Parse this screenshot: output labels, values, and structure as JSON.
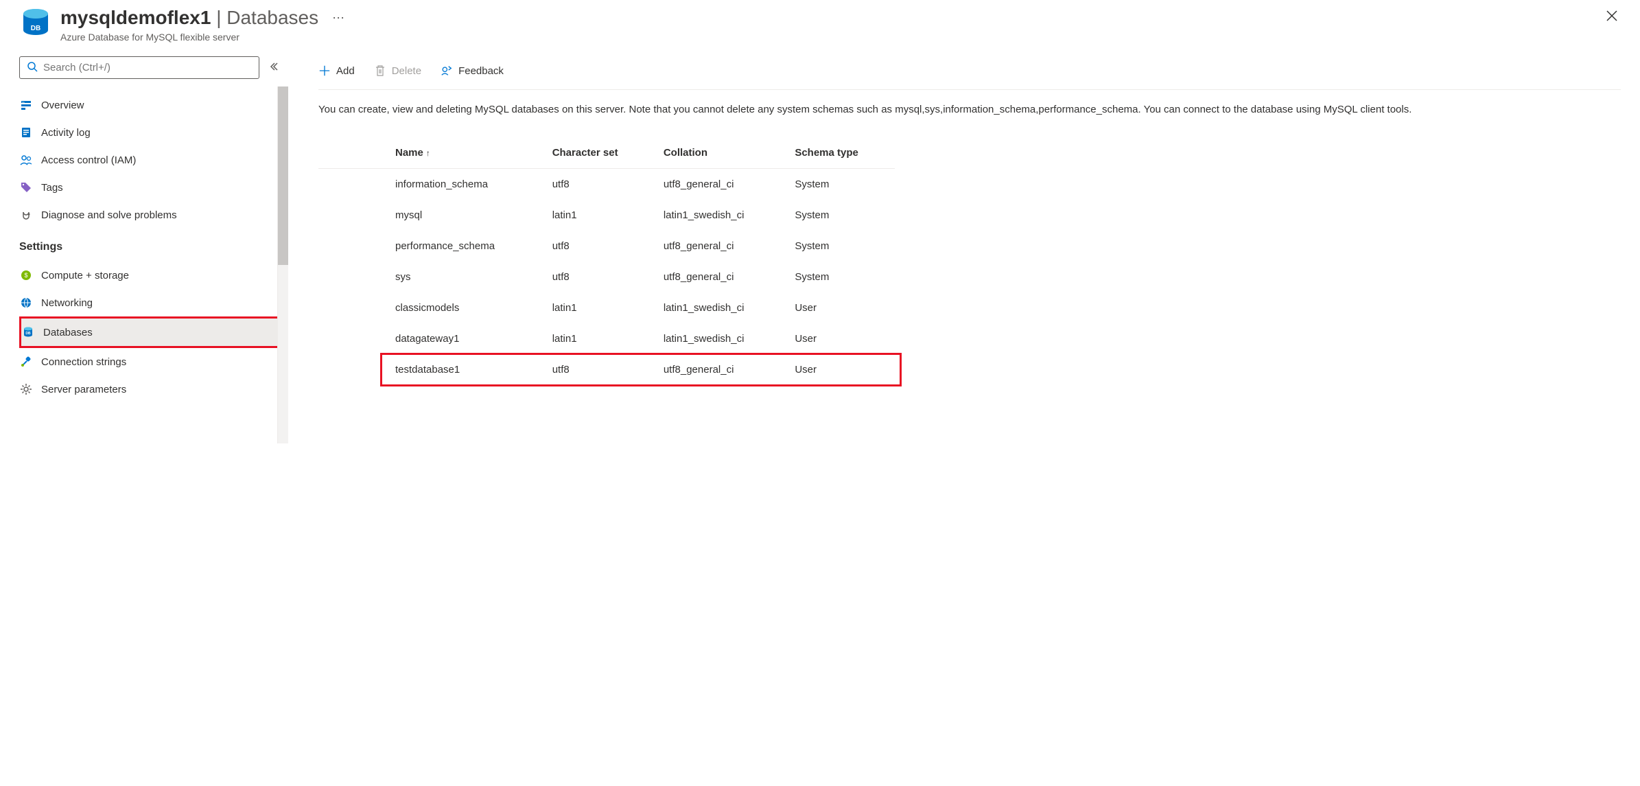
{
  "header": {
    "resource_name": "mysqldemoflex1",
    "section": "Databases",
    "subtitle": "Azure Database for MySQL flexible server",
    "more": "⋯"
  },
  "sidebar": {
    "search_placeholder": "Search (Ctrl+/)",
    "nav_top": [
      {
        "icon": "overview-icon",
        "label": "Overview"
      },
      {
        "icon": "activity-log-icon",
        "label": "Activity log"
      },
      {
        "icon": "access-control-icon",
        "label": "Access control (IAM)"
      },
      {
        "icon": "tags-icon",
        "label": "Tags"
      },
      {
        "icon": "diagnose-icon",
        "label": "Diagnose and solve problems"
      }
    ],
    "settings_label": "Settings",
    "nav_settings": [
      {
        "icon": "compute-storage-icon",
        "label": "Compute + storage"
      },
      {
        "icon": "networking-icon",
        "label": "Networking"
      },
      {
        "icon": "databases-icon",
        "label": "Databases"
      },
      {
        "icon": "connection-strings-icon",
        "label": "Connection strings"
      },
      {
        "icon": "server-parameters-icon",
        "label": "Server parameters"
      }
    ],
    "active_index": 2,
    "highlight_index": 2
  },
  "toolbar": {
    "add_label": "Add",
    "delete_label": "Delete",
    "feedback_label": "Feedback"
  },
  "main": {
    "description": "You can create, view and deleting MySQL databases on this server. Note that you cannot delete any system schemas such as mysql,sys,information_schema,performance_schema. You can connect to the database using MySQL client tools.",
    "columns": [
      {
        "label": "Name",
        "sorted": "asc"
      },
      {
        "label": "Character set"
      },
      {
        "label": "Collation"
      },
      {
        "label": "Schema type"
      }
    ],
    "rows": [
      {
        "name": "information_schema",
        "charset": "utf8",
        "collation": "utf8_general_ci",
        "schema_type": "System"
      },
      {
        "name": "mysql",
        "charset": "latin1",
        "collation": "latin1_swedish_ci",
        "schema_type": "System"
      },
      {
        "name": "performance_schema",
        "charset": "utf8",
        "collation": "utf8_general_ci",
        "schema_type": "System"
      },
      {
        "name": "sys",
        "charset": "utf8",
        "collation": "utf8_general_ci",
        "schema_type": "System"
      },
      {
        "name": "classicmodels",
        "charset": "latin1",
        "collation": "latin1_swedish_ci",
        "schema_type": "User"
      },
      {
        "name": "datagateway1",
        "charset": "latin1",
        "collation": "latin1_swedish_ci",
        "schema_type": "User"
      },
      {
        "name": "testdatabase1",
        "charset": "utf8",
        "collation": "utf8_general_ci",
        "schema_type": "User"
      }
    ],
    "highlight_row_index": 6
  }
}
